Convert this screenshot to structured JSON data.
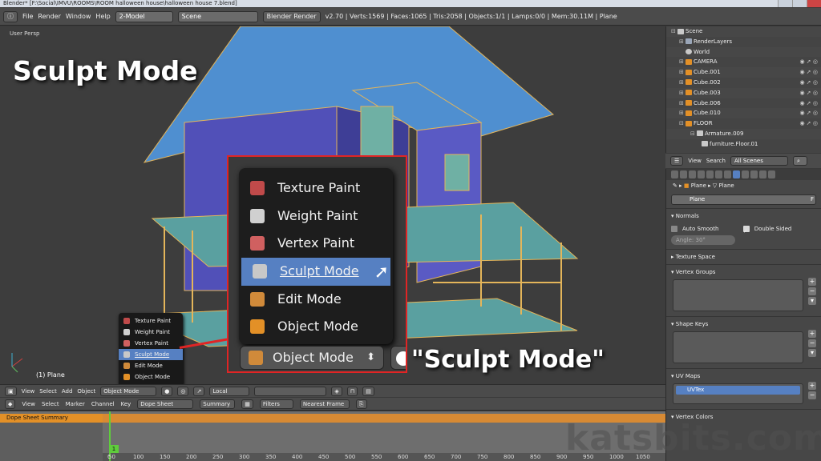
{
  "window": {
    "title": "Blender* [F:\\Social\\IMVU\\ROOMS\\ROOM halloween house\\halloween house 7.blend]"
  },
  "infobar": {
    "menus": [
      "File",
      "Render",
      "Window",
      "Help"
    ],
    "screen_layout": "2-Model",
    "scene": "Scene",
    "engine": "Blender Render",
    "stats": "v2.70 | Verts:1569 | Faces:1065 | Tris:2058 | Objects:1/1 | Lamps:0/0 | Mem:30.11M | Plane"
  },
  "viewport": {
    "view_label": "User Persp",
    "caption": "Sculpt Mode",
    "object_label": "(1) Plane"
  },
  "mode_menu": {
    "items": [
      "Texture Paint",
      "Weight Paint",
      "Vertex Paint",
      "Sculpt Mode",
      "Edit Mode",
      "Object Mode"
    ],
    "selected": "Sculpt Mode",
    "current_mode": "Object Mode"
  },
  "zoom_caption": "\"Sculpt Mode\"",
  "header3d": {
    "menus": [
      "View",
      "Select",
      "Add",
      "Object"
    ],
    "mode": "Object Mode",
    "orientation": "Local"
  },
  "timeline_header": {
    "menus": [
      "View",
      "Select",
      "Marker",
      "Channel",
      "Key"
    ],
    "editor_mode": "Dope Sheet",
    "summary_btn": "Summary",
    "filters_btn": "Filters",
    "snap": "Nearest Frame"
  },
  "dopesheet": {
    "summary_label": "Dope Sheet Summary",
    "current_frame": "1",
    "ticks": [
      "0",
      "50",
      "100",
      "150",
      "200",
      "250",
      "300",
      "350",
      "400",
      "450",
      "500",
      "550",
      "600",
      "650",
      "700",
      "750",
      "800",
      "850",
      "900",
      "950",
      "1000",
      "1050"
    ]
  },
  "outliner": {
    "rows": [
      {
        "label": "Scene",
        "color": "#c9c9c9"
      },
      {
        "label": "RenderLayers",
        "color": "#9aa6b8"
      },
      {
        "label": "World",
        "color": "#c9c9c9"
      },
      {
        "label": "CAMERA",
        "color": "#e39027"
      },
      {
        "label": "Cube.001",
        "color": "#e39027"
      },
      {
        "label": "Cube.002",
        "color": "#e39027"
      },
      {
        "label": "Cube.003",
        "color": "#e39027"
      },
      {
        "label": "Cube.006",
        "color": "#e39027"
      },
      {
        "label": "Cube.010",
        "color": "#e39027"
      },
      {
        "label": "FLOOR",
        "color": "#e39027"
      },
      {
        "label": "Armature.009",
        "color": "#c9c9c9"
      },
      {
        "label": "furniture.Floor.01",
        "color": "#c9c9c9"
      }
    ],
    "header_menus": [
      "View",
      "Search"
    ],
    "scenes_filter": "All Scenes"
  },
  "properties": {
    "breadcrumb_object": "Plane",
    "breadcrumb_data": "Plane",
    "mesh_name": "Plane",
    "mesh_fake_user": "F",
    "normals_title": "Normals",
    "auto_smooth": "Auto Smooth",
    "double_sided": "Double Sided",
    "angle": "Angle:        30°",
    "texture_space": "Texture Space",
    "vertex_groups": "Vertex Groups",
    "shape_keys": "Shape Keys",
    "uv_maps": "UV Maps",
    "uv_entry": "UVTex",
    "vertex_colors": "Vertex Colors"
  },
  "watermark": "katsbits.com",
  "colors": {
    "selection": "#5680c2",
    "accent_orange": "#e39027",
    "zoom_border": "#e02525",
    "frame_green": "#5fcc3c"
  }
}
